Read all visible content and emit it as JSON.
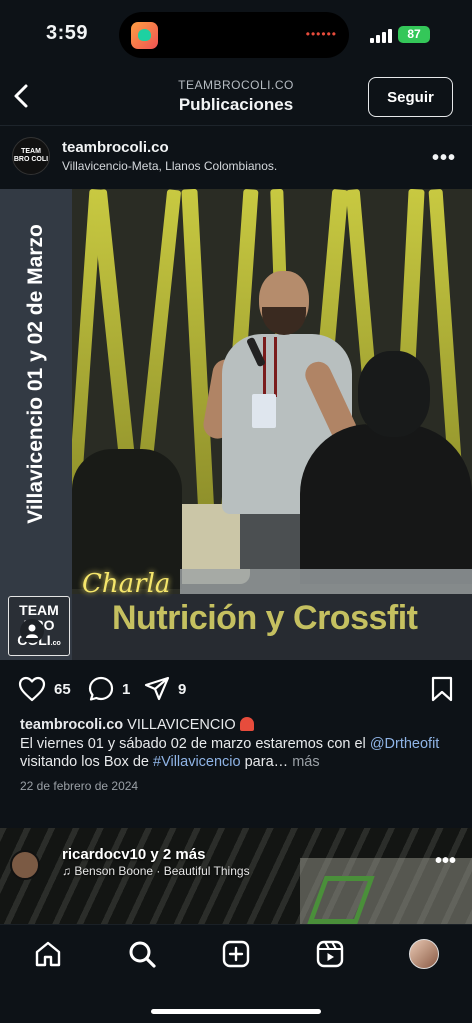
{
  "status_bar": {
    "time": "3:59",
    "battery": "87"
  },
  "header": {
    "account_caps": "TEAMBROCOLI.CO",
    "title": "Publicaciones",
    "follow_label": "Seguir"
  },
  "post": {
    "username": "teambrocoli.co",
    "location": "Villavicencio-Meta, Llanos Colombianos.",
    "avatar_text": "TEAM BRO COLI",
    "image": {
      "side_text": "Villavicencio 01 y 02 de Marzo",
      "script_text": "Charla",
      "headline": "Nutrición y Crossfit",
      "logo_line1": "TEAM",
      "logo_line2": "BRO",
      "logo_line3": "COLI",
      "logo_suffix": ".co"
    },
    "likes": "65",
    "comments": "1",
    "shares": "9",
    "caption": {
      "username": "teambrocoli.co",
      "text1": " VILLAVICENCIO",
      "text2": "El viernes 01 y sábado 02 de marzo estaremos con el ",
      "mention": "@Drtheofit",
      "text3": " visitando los Box de ",
      "hashtag": "#Villavicencio",
      "text4": " para… ",
      "more": "más"
    },
    "date": "22 de febrero de 2024"
  },
  "next_post": {
    "user": "ricardocv10 y 2 más",
    "song": "Benson Boone · Beautiful Things"
  },
  "icons": {
    "back": "chevron-left-icon",
    "like": "heart-icon",
    "comment": "comment-icon",
    "share": "send-icon",
    "save": "bookmark-icon",
    "home": "home-icon",
    "search": "search-icon",
    "create": "plus-square-icon",
    "reels": "reels-icon"
  }
}
